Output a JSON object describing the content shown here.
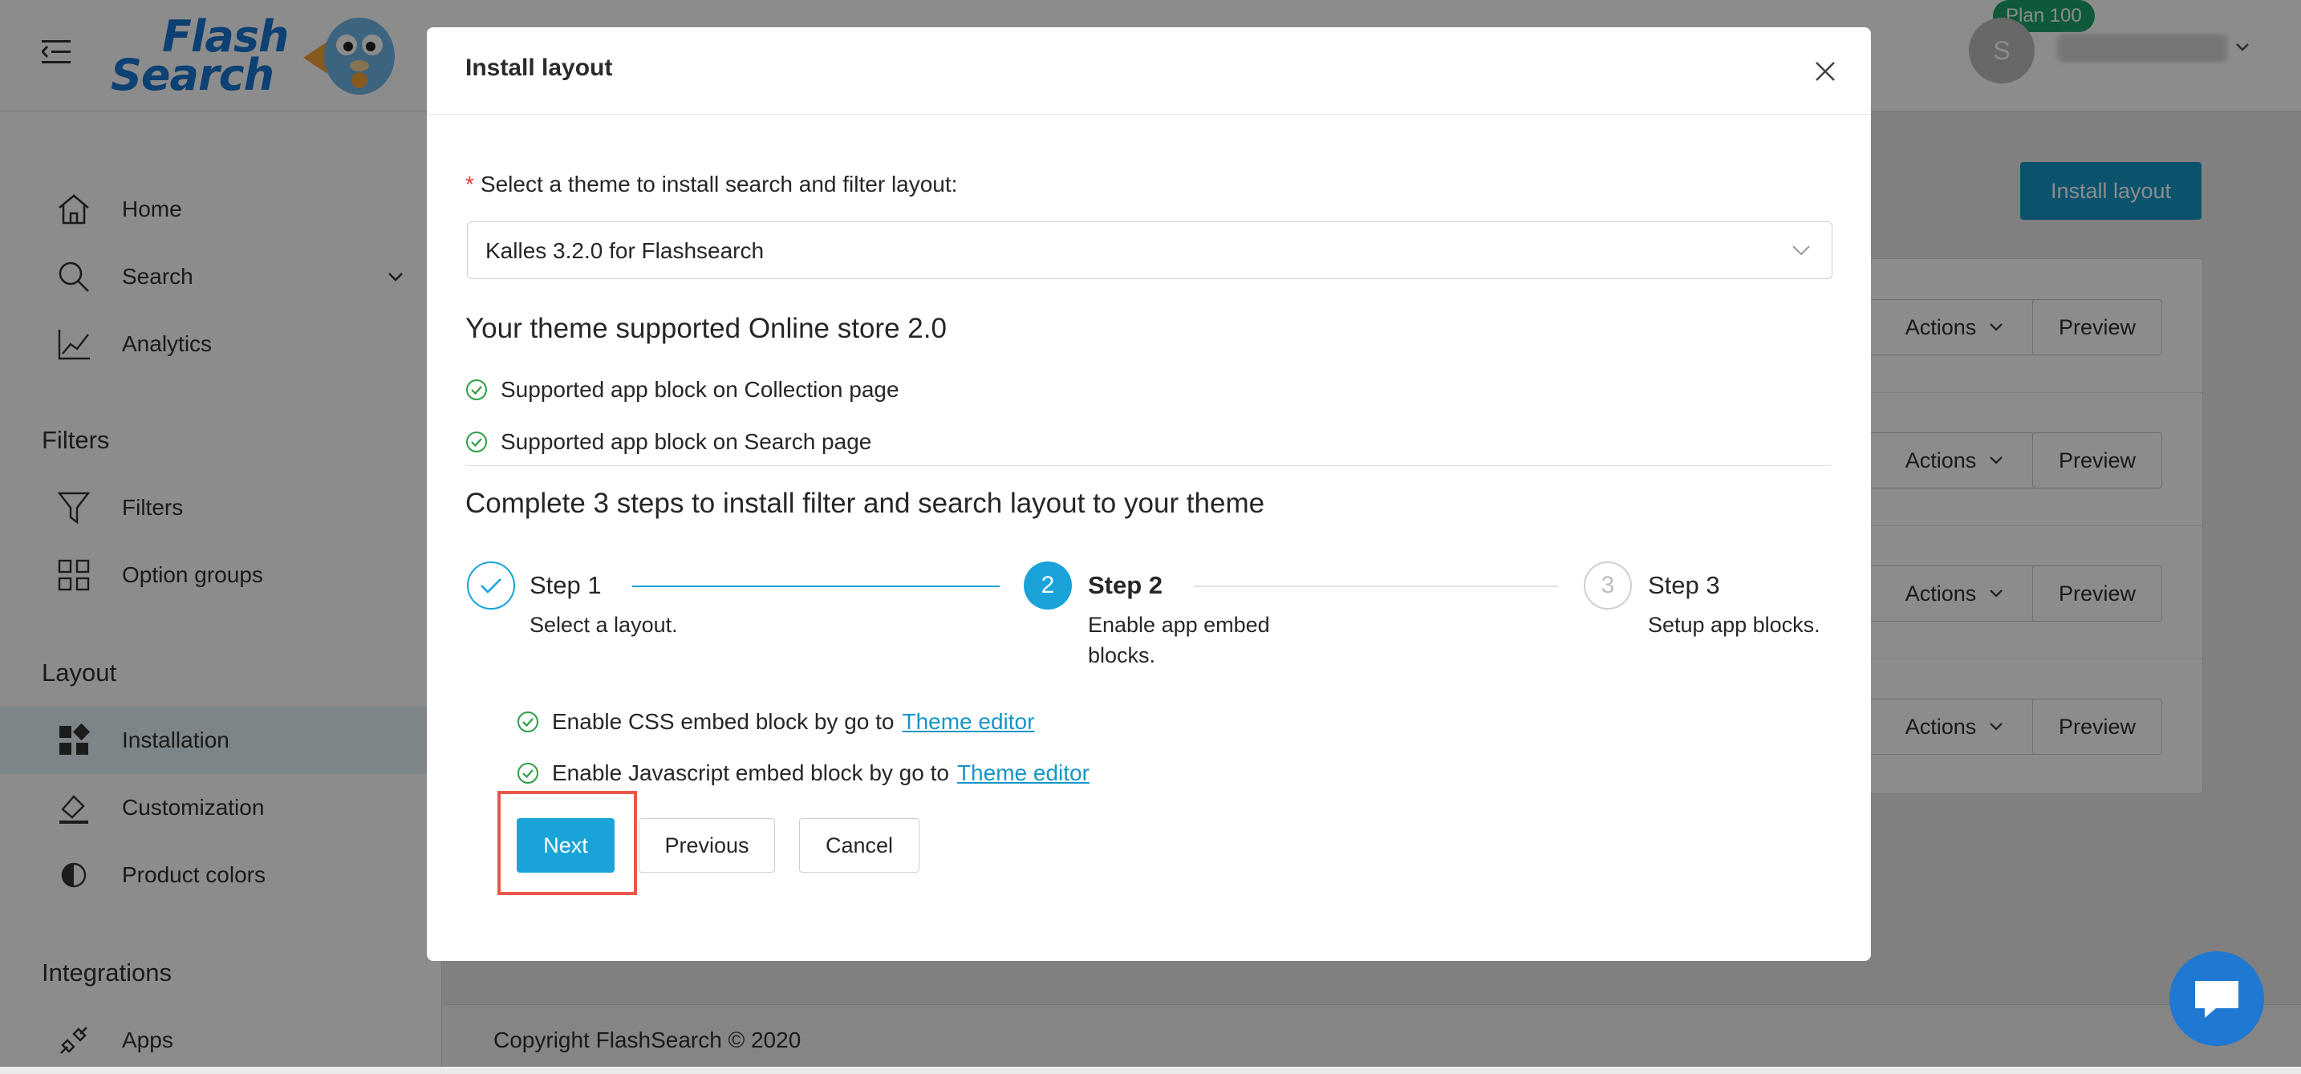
{
  "app": {
    "logo_line1": "Flash",
    "logo_line2": "Search",
    "plan_badge": "Plan 100",
    "avatar_initial": "S"
  },
  "sidebar": {
    "items_top": [
      {
        "label": "Home",
        "icon": "home-icon"
      },
      {
        "label": "Search",
        "icon": "search-icon"
      },
      {
        "label": "Analytics",
        "icon": "analytics-icon"
      }
    ],
    "section_filters": "Filters",
    "items_filters": [
      {
        "label": "Filters",
        "icon": "filter-icon"
      },
      {
        "label": "Option groups",
        "icon": "option-groups-icon"
      }
    ],
    "section_layout": "Layout",
    "items_layout": [
      {
        "label": "Installation",
        "icon": "installation-icon",
        "active": true
      },
      {
        "label": "Customization",
        "icon": "customization-icon"
      },
      {
        "label": "Product colors",
        "icon": "product-colors-icon"
      }
    ],
    "section_integrations": "Integrations",
    "items_integrations": [
      {
        "label": "Apps",
        "icon": "apps-icon"
      }
    ]
  },
  "main": {
    "install_button": "Install layout",
    "rows": [
      {
        "actions": "Actions",
        "preview": "Preview"
      },
      {
        "actions": "Actions",
        "preview": "Preview"
      },
      {
        "actions": "Actions",
        "preview": "Preview"
      },
      {
        "actions": "Actions",
        "preview": "Preview"
      }
    ],
    "footer": "Copyright FlashSearch © 2020"
  },
  "modal": {
    "title": "Install layout",
    "select_label": "Select a theme to install search and filter layout:",
    "select_value": "Kalles 3.2.0 for Flashsearch",
    "support_heading": "Your theme supported Online store 2.0",
    "support_items": [
      "Supported app block on Collection page",
      "Supported app block on Search page"
    ],
    "steps_heading": "Complete 3 steps to install filter and search layout to your theme",
    "steps": [
      {
        "number": "1",
        "title": "Step 1",
        "desc": "Select a layout.",
        "state": "done"
      },
      {
        "number": "2",
        "title": "Step 2",
        "desc_line1": "Enable app embed",
        "desc_line2": "blocks.",
        "state": "active"
      },
      {
        "number": "3",
        "title": "Step 3",
        "desc": "Setup app blocks.",
        "state": "pending"
      }
    ],
    "embed_items": [
      {
        "text": "Enable CSS embed block by go to",
        "link": "Theme editor"
      },
      {
        "text": "Enable Javascript embed block by go to",
        "link": "Theme editor"
      }
    ],
    "buttons": {
      "next": "Next",
      "previous": "Previous",
      "cancel": "Cancel"
    }
  },
  "colors": {
    "accent": "#1aa3d9",
    "success": "#2e9e44",
    "highlight": "#e8564a"
  }
}
